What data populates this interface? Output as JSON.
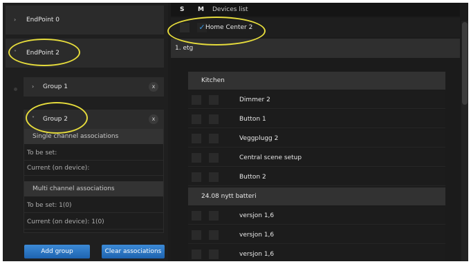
{
  "left_panel": {
    "endpoints": [
      {
        "label": "EndPoint 0",
        "chevron": "›"
      },
      {
        "label": "EndPoint 2",
        "chevron": "˅"
      }
    ],
    "groups": [
      {
        "label": "Group 1",
        "chevron": "›",
        "remove": "x"
      },
      {
        "label": "Group 2",
        "chevron": "˅",
        "remove": "x"
      }
    ],
    "single_channel": {
      "title": "Single channel associations",
      "to_be_set": "To be set:",
      "current": "Current (on device):"
    },
    "multi_channel": {
      "title": "Multi channel associations",
      "to_be_set": "To be set: 1(0)",
      "current": "Current (on device): 1(0)"
    },
    "buttons": {
      "add_group": "Add group",
      "clear_associations": "Clear associations"
    }
  },
  "right_panel": {
    "header": {
      "s": "S",
      "m": "M",
      "title": "Devices list"
    },
    "home_center": {
      "label": "Home Center 2",
      "check": "✓"
    },
    "floor": "1. etg",
    "sections": [
      {
        "title": "Kitchen",
        "devices": [
          "Dimmer 2",
          "Button 1",
          "Veggplugg 2",
          "Central scene setup",
          "Button 2"
        ]
      },
      {
        "title": "24.08 nytt batteri",
        "devices": [
          "versjon 1,6",
          "versjon 1,6",
          "versjon 1,6"
        ]
      }
    ]
  },
  "colors": {
    "background": "#1c1c1c",
    "accent_button": "#2f78c8",
    "check": "#3b9be8",
    "highlight": "#e6dc3c"
  }
}
